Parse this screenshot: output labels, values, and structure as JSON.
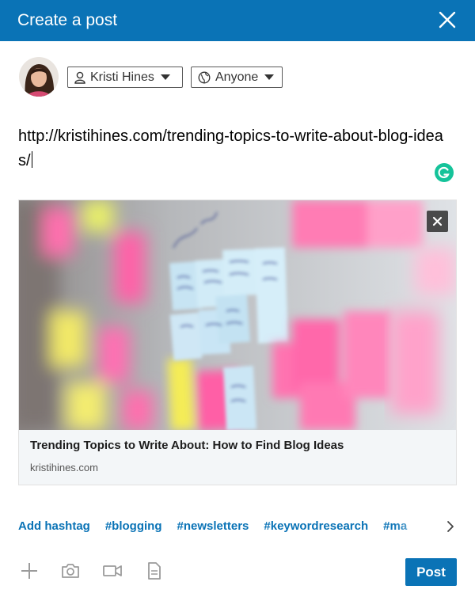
{
  "header": {
    "title": "Create a post",
    "close_icon": "close-icon",
    "background": "#0a73b6"
  },
  "composer": {
    "avatar_icon": "user-avatar",
    "author_label": "Kristi Hines",
    "author_icon": "person-icon",
    "visibility_label": "Anyone",
    "visibility_icon": "globe-icon",
    "text": "http://kristihines.com/trending-topics-to-write-about-blog-ideas/",
    "grammarly_icon": "grammarly-icon"
  },
  "link_preview": {
    "title": "Trending Topics to Write About: How to Find Blog Ideas",
    "domain": "kristihines.com",
    "remove_icon": "close-icon",
    "image": "sticky-notes-photo"
  },
  "hashtags": {
    "items": [
      "Add hashtag",
      "#blogging",
      "#newsletters",
      "#keywordresearch",
      "#ma"
    ],
    "next_icon": "chevron-right-icon"
  },
  "toolbar": {
    "tools": [
      "plus-icon",
      "camera-icon",
      "video-icon",
      "document-icon"
    ],
    "post_label": "Post",
    "accent": "#0a73b6"
  }
}
